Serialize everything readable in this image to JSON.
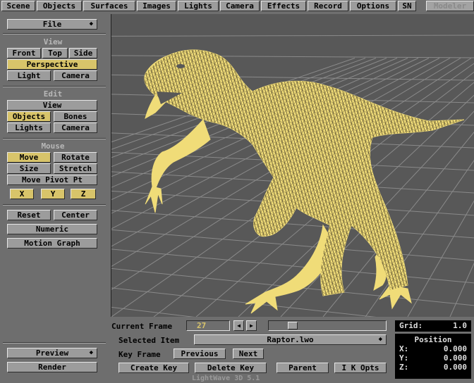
{
  "menu_tabs": [
    "Scene",
    "Objects",
    "Surfaces",
    "Images",
    "Lights",
    "Camera",
    "Effects",
    "Record",
    "Options",
    "SN"
  ],
  "modeler_label": "Modeler",
  "file_label": "File",
  "sections": {
    "view": "View",
    "edit": "Edit",
    "mouse": "Mouse"
  },
  "view_buttons": {
    "front": "Front",
    "top": "Top",
    "side": "Side",
    "perspective": "Perspective",
    "light": "Light",
    "camera": "Camera"
  },
  "edit_buttons": {
    "view": "View",
    "objects": "Objects",
    "bones": "Bones",
    "lights": "Lights",
    "camera": "Camera"
  },
  "mouse_buttons": {
    "move": "Move",
    "rotate": "Rotate",
    "size": "Size",
    "stretch": "Stretch",
    "move_pivot": "Move Pivot Pt",
    "x": "X",
    "y": "Y",
    "z": "Z"
  },
  "tools": {
    "reset": "Reset",
    "center": "Center",
    "numeric": "Numeric",
    "motion_graph": "Motion Graph"
  },
  "bottom_left": {
    "preview": "Preview",
    "render": "Render"
  },
  "timeline": {
    "current_frame_label": "Current Frame",
    "current_frame_value": "27",
    "slider_position": 0.17,
    "selected_item_label": "Selected Item",
    "selected_item_value": "Raptor.lwo",
    "key_frame_label": "Key Frame",
    "previous": "Previous",
    "next": "Next",
    "create_key": "Create Key",
    "delete_key": "Delete Key",
    "parent": "Parent",
    "ik_opts": "I K Opts"
  },
  "grid": {
    "label": "Grid:",
    "value": "1.0"
  },
  "position": {
    "title": "Position",
    "x_label": "X:",
    "x_value": "0.000",
    "y_label": "Y:",
    "y_value": "0.000",
    "z_label": "Z:",
    "z_value": "0.000"
  },
  "footer_label": "LightWave 3D 5.1",
  "colors": {
    "wireframe": "#f0dc78",
    "active_button": "#d8c46a",
    "grid_lines": "#8a8a8a"
  }
}
